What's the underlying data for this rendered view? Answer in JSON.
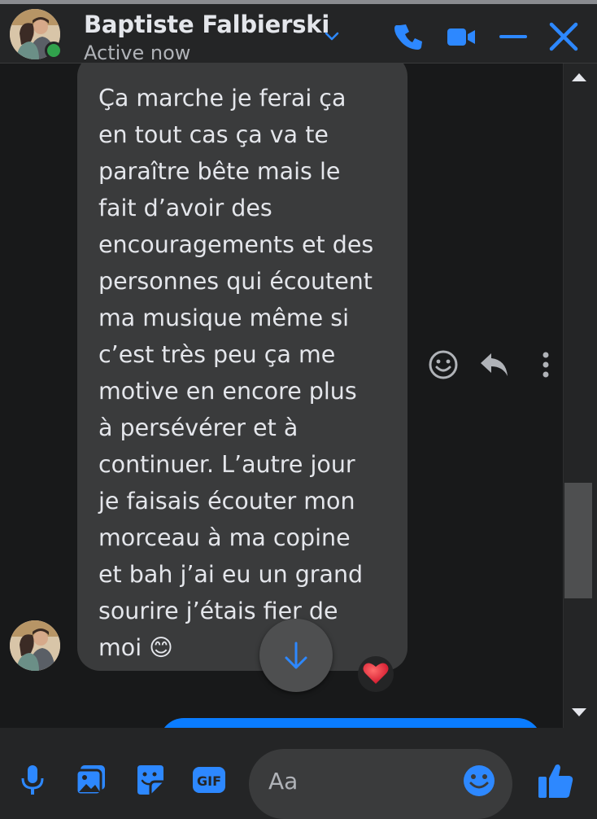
{
  "header": {
    "contact_name": "Baptiste Falbierski",
    "status": "Active now",
    "icons": [
      "chevron-down-icon",
      "phone-icon",
      "video-icon",
      "minimize-icon",
      "close-icon"
    ]
  },
  "colors": {
    "accent": "#0a7cff",
    "online": "#31a24c",
    "bubble": "#3a3b3c",
    "chat_bg": "#18191a",
    "panel": "#242526",
    "icon_blue": "#2d88ff"
  },
  "message": {
    "text": "Ça marche je ferai ça\nen tout cas ça va te\nparaître bête mais le\nfait d’avoir des\nencouragements et des\npersonnes qui écoutent\nma musique même si\nc’est très peu ça me\nmotive en encore plus\nà persévérer et à\ncontinuer. L’autre jour\nje faisais écouter mon\nmorceau à ma copine\net bah j’ai eu un grand\nsourire j’étais fier de\nmoi 😊",
    "reaction": "❤️",
    "hover_actions": [
      "react-icon",
      "reply-icon",
      "more-options-icon"
    ]
  },
  "composer": {
    "placeholder": "Aa",
    "icons": [
      "microphone-icon",
      "photo-icon",
      "sticker-icon",
      "gif-icon",
      "emoji-icon",
      "like-icon"
    ],
    "gif_label": "GIF"
  }
}
